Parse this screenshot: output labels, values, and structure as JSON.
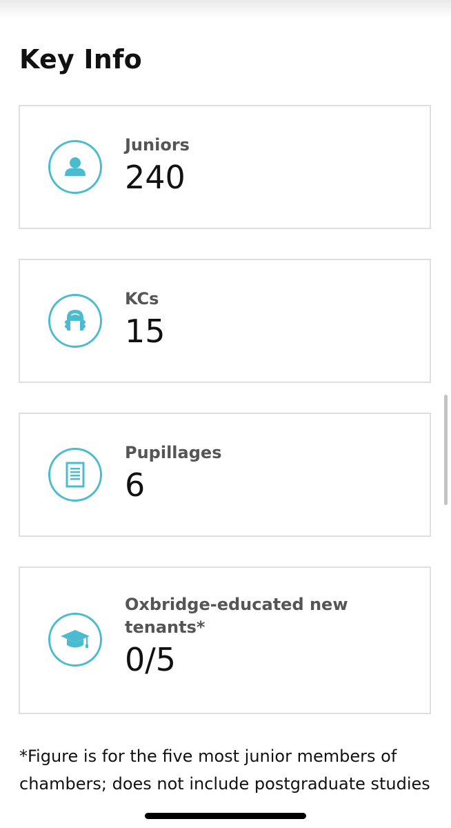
{
  "section": {
    "title": "Key Info"
  },
  "cards": [
    {
      "label": "Juniors",
      "value": "240",
      "icon": "person-icon"
    },
    {
      "label": "KCs",
      "value": "15",
      "icon": "barrister-wig-icon"
    },
    {
      "label": "Pupillages",
      "value": "6",
      "icon": "document-icon"
    },
    {
      "label": "Oxbridge-educated new tenants*",
      "value": "0/5",
      "icon": "graduation-cap-icon"
    }
  ],
  "footnote": "*Figure is for the five most junior members of chambers; does not include postgraduate studies",
  "colors": {
    "accent": "#4bbcd0",
    "label": "#555555",
    "value": "#111111",
    "card_border": "#dedede"
  }
}
